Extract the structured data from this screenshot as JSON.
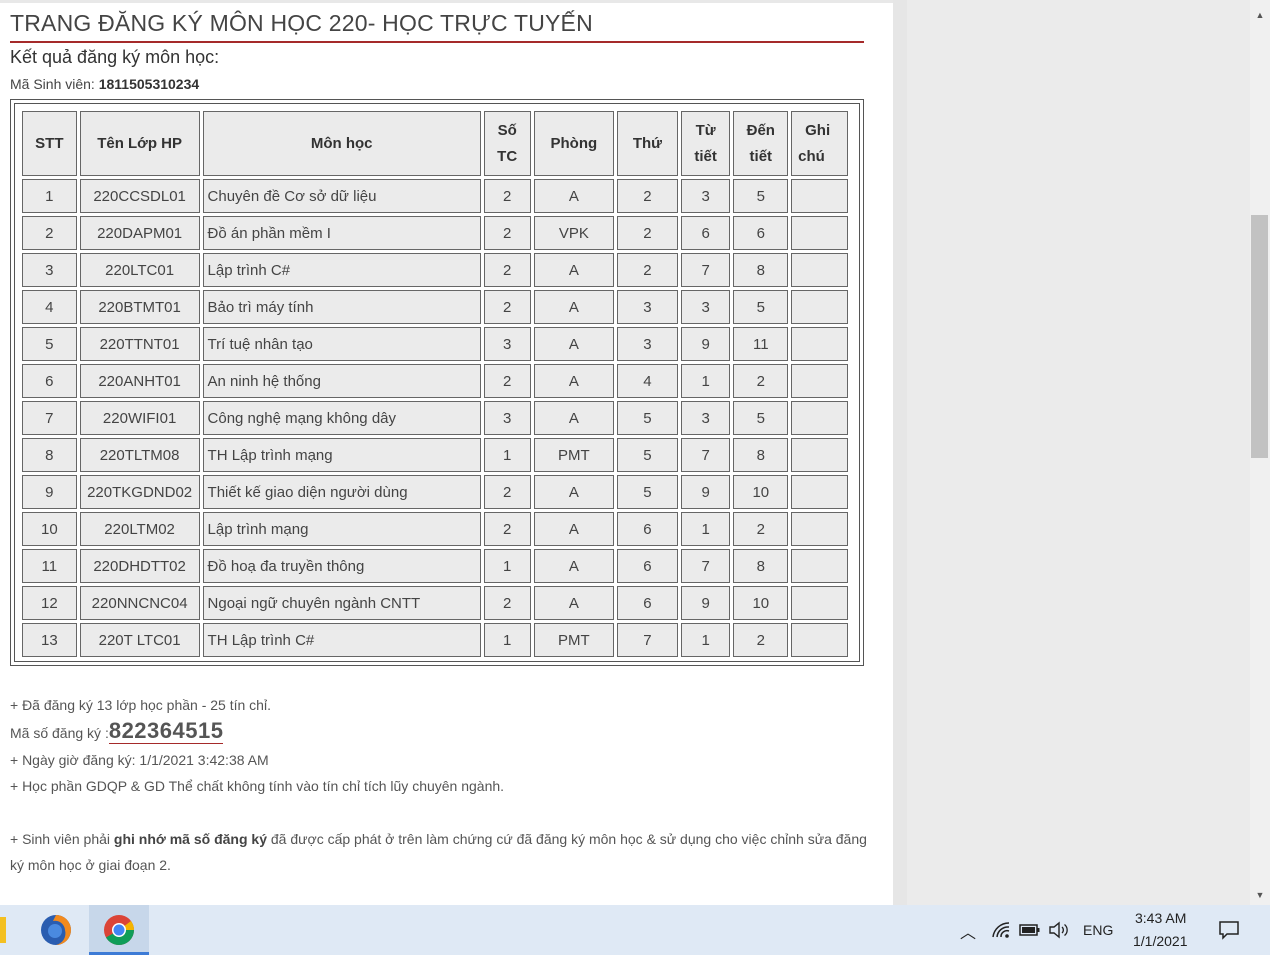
{
  "page": {
    "title": "TRANG ĐĂNG KÝ MÔN HỌC 220- HỌC TRỰC TUYẾN",
    "subtitle": "Kết quả đăng ký môn học:",
    "student_label": "Mã Sinh viên: ",
    "student_id": "1811505310234"
  },
  "table": {
    "headers": {
      "stt": "STT",
      "class_code": "Tên Lớp HP",
      "course": "Môn học",
      "credits_1": "Số",
      "credits_2": "TC",
      "room": "Phòng",
      "day": "Thứ",
      "from_1": "Từ",
      "from_2": "tiết",
      "to_1": "Đến",
      "to_2": "tiết",
      "note_1": "Ghi",
      "note_2": "chú"
    },
    "rows": [
      {
        "stt": "1",
        "class_code": "220CCSDL01",
        "course": "Chuyên đề Cơ sở dữ liệu",
        "credits": "2",
        "room": "A",
        "day": "2",
        "from": "3",
        "to": "5",
        "note": ""
      },
      {
        "stt": "2",
        "class_code": "220DAPM01",
        "course": "Đồ án phần mềm I",
        "credits": "2",
        "room": "VPK",
        "day": "2",
        "from": "6",
        "to": "6",
        "note": ""
      },
      {
        "stt": "3",
        "class_code": "220LTC01",
        "course": "Lập trình C#",
        "credits": "2",
        "room": "A",
        "day": "2",
        "from": "7",
        "to": "8",
        "note": ""
      },
      {
        "stt": "4",
        "class_code": "220BTMT01",
        "course": "Bảo trì máy tính",
        "credits": "2",
        "room": "A",
        "day": "3",
        "from": "3",
        "to": "5",
        "note": ""
      },
      {
        "stt": "5",
        "class_code": "220TTNT01",
        "course": "Trí tuệ nhân tạo",
        "credits": "3",
        "room": "A",
        "day": "3",
        "from": "9",
        "to": "11",
        "note": ""
      },
      {
        "stt": "6",
        "class_code": "220ANHT01",
        "course": "An ninh hệ thống",
        "credits": "2",
        "room": "A",
        "day": "4",
        "from": "1",
        "to": "2",
        "note": ""
      },
      {
        "stt": "7",
        "class_code": "220WIFI01",
        "course": "Công nghệ mạng không dây",
        "credits": "3",
        "room": "A",
        "day": "5",
        "from": "3",
        "to": "5",
        "note": ""
      },
      {
        "stt": "8",
        "class_code": "220TLTM08",
        "course": "TH Lập trình mạng",
        "credits": "1",
        "room": "PMT",
        "day": "5",
        "from": "7",
        "to": "8",
        "note": ""
      },
      {
        "stt": "9",
        "class_code": "220TKGDND02",
        "course": "Thiết kế giao diện người dùng",
        "credits": "2",
        "room": "A",
        "day": "5",
        "from": "9",
        "to": "10",
        "note": ""
      },
      {
        "stt": "10",
        "class_code": "220LTM02",
        "course": "Lập trình mạng",
        "credits": "2",
        "room": "A",
        "day": "6",
        "from": "1",
        "to": "2",
        "note": ""
      },
      {
        "stt": "11",
        "class_code": "220DHDTT02",
        "course": "Đồ hoạ đa truyền thông",
        "credits": "1",
        "room": "A",
        "day": "6",
        "from": "7",
        "to": "8",
        "note": ""
      },
      {
        "stt": "12",
        "class_code": "220NNCNC04",
        "course": "Ngoại ngữ chuyên ngành CNTT",
        "credits": "2",
        "room": "A",
        "day": "6",
        "from": "9",
        "to": "10",
        "note": ""
      },
      {
        "stt": "13",
        "class_code": "220T LTC01",
        "course": "TH Lập trình C#",
        "credits": "1",
        "room": "PMT",
        "day": "7",
        "from": "1",
        "to": "2",
        "note": ""
      }
    ]
  },
  "summary": {
    "registered": "+ Đã đăng ký 13 lớp học phần - 25 tín chỉ.",
    "code_label": "Mã số đăng ký :",
    "code_value": "822364515",
    "datetime": "+ Ngày giờ đăng ký: 1/1/2021 3:42:38 AM",
    "gdqp": "+ Học phần GDQP & GD Thể chất không tính vào tín chỉ tích lũy chuyên ngành.",
    "note_prefix": "+ Sinh viên phải ",
    "note_bold": "ghi nhớ mã số đăng ký",
    "note_suffix": " đã được cấp phát ở trên làm chứng cứ đã đăng ký môn học & sử dụng cho việc chỉnh sửa đăng ký môn học ở giai đoạn 2."
  },
  "taskbar": {
    "apps": [
      {
        "name": "firefox-icon"
      },
      {
        "name": "chrome-icon"
      }
    ],
    "language": "ENG",
    "time": "3:43 AM",
    "date": "1/1/2021"
  },
  "colors": {
    "accent": "#a52a2a",
    "cell_bg": "#ebebeb",
    "taskbar_bg": "#dfe9f5"
  }
}
